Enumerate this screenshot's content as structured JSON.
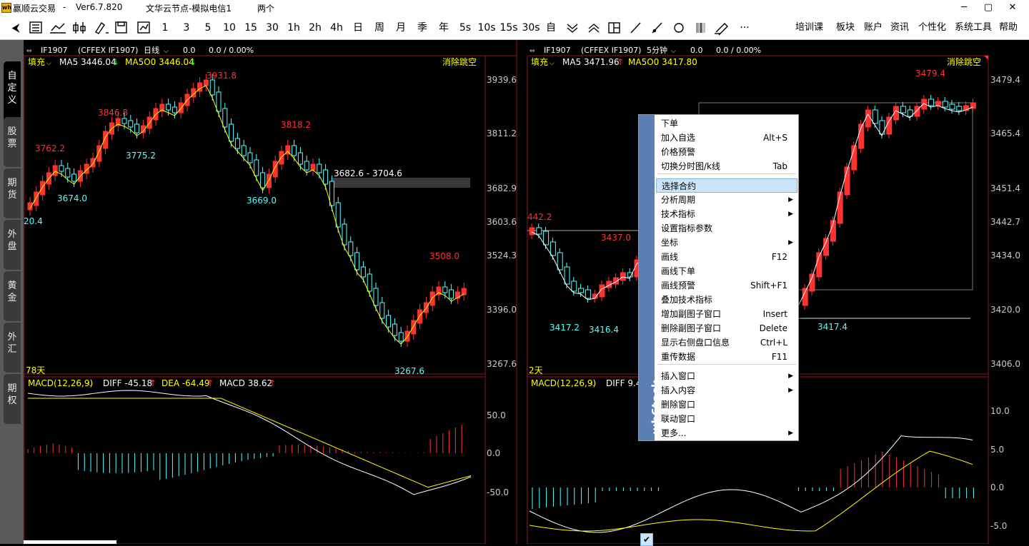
{
  "titlebar": {
    "app": "赢顺云交易",
    "version": "Ver6.7.820",
    "node": "文华云节点-模拟电信1",
    "user": "两个",
    "min": "─",
    "max": "▢",
    "close": "✕"
  },
  "toolbar": {
    "back": "⮜",
    "periods": [
      "1",
      "3",
      "5",
      "10",
      "15",
      "30",
      "1h",
      "2h",
      "4h",
      "日",
      "周",
      "月",
      "季",
      "年",
      "5s",
      "10s",
      "15s",
      "30s",
      "自"
    ],
    "more": "···",
    "right": [
      "培训课",
      "板块",
      "账户",
      "资讯",
      "个性化",
      "系统工具",
      "帮助"
    ]
  },
  "sidebar": [
    "自定义",
    "股票",
    "期货",
    "外盘",
    "黄金",
    "外汇",
    "期权"
  ],
  "left_chart": {
    "header": {
      "symbol": "IF1907",
      "exchange": "(CFFEX IF1907)",
      "period": "日线",
      "price": "0.0",
      "change": "0.0 / 0.00%"
    },
    "info": {
      "fill": "填充",
      "ma5": "MA5 3446.04",
      "ma5_arrow": "↓",
      "ma50": "MA5O0 3446.04",
      "ma50_arrow": "↓",
      "clear": "消除跳空"
    },
    "days": "78天",
    "gap_label": "3682.6 - 3704.6",
    "annotations": [
      "3762.2",
      "3846.8",
      "3931.8",
      "3818.2",
      "3508.0",
      "20.4",
      "3674.0",
      "3775.2",
      "3669.0",
      "3267.6"
    ],
    "yaxis": [
      "3939.6",
      "3811.2",
      "3682.9",
      "3603.6",
      "3524.3",
      "3396.0",
      "3267.6"
    ],
    "macd": {
      "title": "MACD(12,26,9)",
      "diff": "DIFF -45.18",
      "diff_arrow": "↑",
      "dea": "DEA -64.49",
      "dea_arrow": "↑",
      "macd": "MACD 38.62",
      "macd_arrow": "↑"
    },
    "macd_axis": [
      "50.0",
      "0.0",
      "-50.0"
    ]
  },
  "right_chart": {
    "header": {
      "symbol": "IF1907",
      "exchange": "(CFFEX IF1907)",
      "period": "5分钟",
      "price": "0.0",
      "change": "0.0 / 0.00%"
    },
    "info": {
      "fill": "填充",
      "ma5": "MA5 3471.96",
      "ma5_arrow": "↑",
      "ma50": "MA5O0 3417.80",
      "clear": "消除跳空"
    },
    "days": "2天",
    "annotations": [
      "3479.4",
      "442.2",
      "3437.0",
      "3417.2",
      "3416.4",
      "3417.4"
    ],
    "yaxis": [
      "3479.4",
      "3465.4",
      "3451.4",
      "3442.7",
      "3434.0",
      "3420.0",
      "3406.0"
    ],
    "macd": {
      "title": "MACD(12,26,9)",
      "diff": "DIFF 9.4"
    },
    "macd_axis": [
      "10.0",
      "5.0",
      "0.0",
      "-5.0"
    ]
  },
  "context_menu": {
    "brand": "wh6tock",
    "items": [
      {
        "label": "下单",
        "shortcut": ""
      },
      {
        "label": "加入自选",
        "shortcut": "Alt+S"
      },
      {
        "label": "价格预警",
        "shortcut": ""
      },
      {
        "label": "切换分时图/k线",
        "shortcut": "Tab"
      },
      {
        "label": "选择合约",
        "shortcut": ""
      },
      {
        "label": "分析周期",
        "shortcut": "▶"
      },
      {
        "label": "技术指标",
        "shortcut": "▶"
      },
      {
        "label": "设置指标参数",
        "shortcut": ""
      },
      {
        "label": "坐标",
        "shortcut": "▶"
      },
      {
        "label": "画线",
        "shortcut": "F12"
      },
      {
        "label": "画线下单",
        "shortcut": ""
      },
      {
        "label": "画线预警",
        "shortcut": "Shift+F1"
      },
      {
        "label": "叠加技术指标",
        "shortcut": ""
      },
      {
        "label": "增加副图子窗口",
        "shortcut": "Insert"
      },
      {
        "label": "删除副图子窗口",
        "shortcut": "Delete"
      },
      {
        "label": "显示右侧盘口信息",
        "shortcut": "Ctrl+L"
      },
      {
        "label": "重传数据",
        "shortcut": "F11"
      },
      {
        "label": "插入窗口",
        "shortcut": "▶"
      },
      {
        "label": "插入内容",
        "shortcut": "▶"
      },
      {
        "label": "删除窗口",
        "shortcut": ""
      },
      {
        "label": "联动窗口",
        "shortcut": ""
      },
      {
        "label": "更多...",
        "shortcut": "▶"
      }
    ],
    "checked_mark": "✔"
  },
  "colors": {
    "up": "#ff3232",
    "down": "#54ffff",
    "ma": "#ffff00",
    "axis": "#c8c8c8",
    "frame": "#8b1a1a"
  }
}
